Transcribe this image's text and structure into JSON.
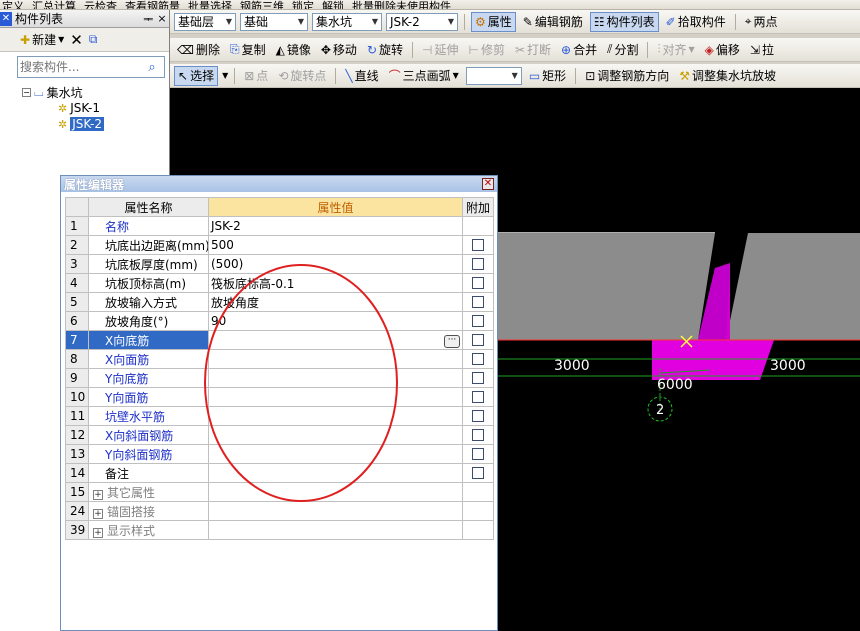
{
  "menubar": {
    "items": [
      "定义",
      "汇总计算",
      "云检查",
      "查看钢筋量",
      "批量选择",
      "钢筋三维",
      "锁定",
      "解锁",
      "批量删除未使用构件"
    ]
  },
  "component_list": {
    "title": "构件列表",
    "new_label": "新建",
    "search_placeholder": "搜索构件...",
    "tree": {
      "root": "集水坑",
      "children": [
        "JSK-1",
        "JSK-2"
      ],
      "selected": "JSK-2"
    }
  },
  "toolbar1": {
    "floor": "基础层",
    "category": "基础",
    "type": "集水坑",
    "component": "JSK-2",
    "properties": "属性",
    "edit_rebar": "编辑钢筋",
    "component_list": "构件列表",
    "pick_component": "拾取构件",
    "two_points": "两点"
  },
  "toolbar2": {
    "delete": "删除",
    "copy": "复制",
    "mirror": "镜像",
    "move": "移动",
    "rotate": "旋转",
    "extend": "延伸",
    "trim": "修剪",
    "break": "打断",
    "merge": "合并",
    "split": "分割",
    "align": "对齐",
    "offset": "偏移",
    "stretch": "拉"
  },
  "toolbar3": {
    "select": "选择",
    "point": "点",
    "rotate_point": "旋转点",
    "line": "直线",
    "arc3": "三点画弧",
    "rect": "矩形",
    "adjust_dir": "调整钢筋方向",
    "adjust_slope": "调整集水坑放坡"
  },
  "canvas": {
    "dim_left": "3000",
    "dim_right": "3000",
    "dim_bottom": "6000",
    "axis_label": "2"
  },
  "property_editor": {
    "title": "属性编辑器",
    "headers": {
      "name": "属性名称",
      "value": "属性值",
      "extra": "附加"
    },
    "rows": [
      {
        "num": "1",
        "name": "名称",
        "value": "JSK-2",
        "style": "blue",
        "check": false
      },
      {
        "num": "2",
        "name": "坑底出边距离(mm)",
        "value": "500",
        "style": "",
        "check": true
      },
      {
        "num": "3",
        "name": "坑底板厚度(mm)",
        "value": "(500)",
        "style": "",
        "check": true
      },
      {
        "num": "4",
        "name": "坑板顶标高(m)",
        "value": "筏板底标高-0.1",
        "style": "",
        "check": true
      },
      {
        "num": "5",
        "name": "放坡输入方式",
        "value": "放坡角度",
        "style": "",
        "check": true
      },
      {
        "num": "6",
        "name": "放坡角度(°)",
        "value": "90",
        "style": "",
        "check": true
      },
      {
        "num": "7",
        "name": "X向底筋",
        "value": "",
        "style": "blue",
        "check": true,
        "active": true
      },
      {
        "num": "8",
        "name": "X向面筋",
        "value": "",
        "style": "blue",
        "check": true
      },
      {
        "num": "9",
        "name": "Y向底筋",
        "value": "",
        "style": "blue",
        "check": true
      },
      {
        "num": "10",
        "name": "Y向面筋",
        "value": "",
        "style": "blue",
        "check": true
      },
      {
        "num": "11",
        "name": "坑壁水平筋",
        "value": "",
        "style": "blue",
        "check": true
      },
      {
        "num": "12",
        "name": "X向斜面钢筋",
        "value": "",
        "style": "blue",
        "check": true
      },
      {
        "num": "13",
        "name": "Y向斜面钢筋",
        "value": "",
        "style": "blue",
        "check": true
      },
      {
        "num": "14",
        "name": "备注",
        "value": "",
        "style": "",
        "check": true
      },
      {
        "num": "15",
        "name": "其它属性",
        "value": "",
        "style": "grey",
        "group": true
      },
      {
        "num": "24",
        "name": "锚固搭接",
        "value": "",
        "style": "grey",
        "group": true
      },
      {
        "num": "39",
        "name": "显示样式",
        "value": "",
        "style": "grey",
        "group": true
      }
    ]
  },
  "colors": {
    "canvas": "#000000",
    "magenta": "#e000e0",
    "slab": "#a9a9a9",
    "annotation_circle": "#e02020",
    "selection": "#316ac5"
  }
}
